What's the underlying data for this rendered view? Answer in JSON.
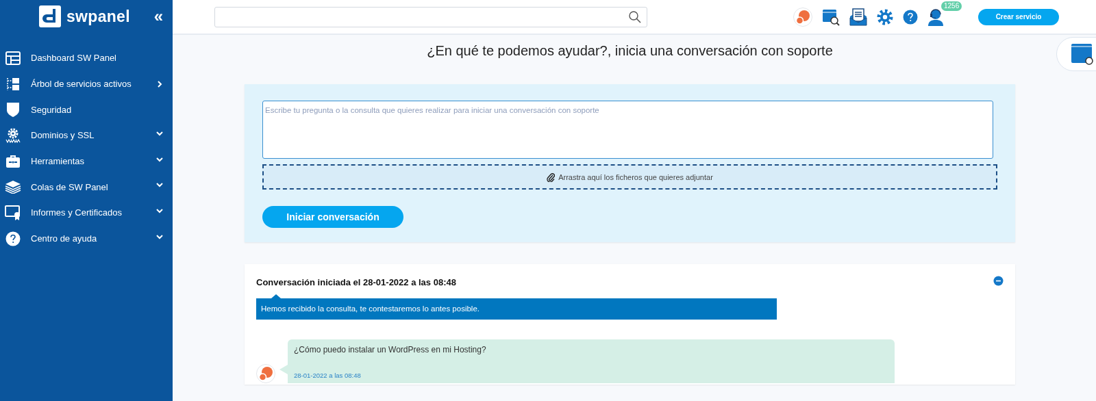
{
  "sidebar": {
    "logo": "swpanel",
    "collapse": "«",
    "items": [
      {
        "label": "Dashboard SW Panel",
        "kind": "link"
      },
      {
        "label": "Árbol de servicios activos",
        "kind": "flyout"
      },
      {
        "label": "Seguridad",
        "kind": "link"
      },
      {
        "label": "Dominios y SSL",
        "kind": "dropdown"
      },
      {
        "label": "Herramientas",
        "kind": "dropdown"
      },
      {
        "label": "Colas de SW Panel",
        "kind": "dropdown"
      },
      {
        "label": "Informes y Certificados",
        "kind": "dropdown"
      },
      {
        "label": "Centro de ayuda",
        "kind": "dropdown"
      }
    ]
  },
  "topbar": {
    "badge": "1256",
    "button": "Crear servicio"
  },
  "heading": "¿En qué te podemos ayudar?, inicia una conversación con soporte",
  "form": {
    "placeholder": "Escribe tu pregunta o la consulta que quieres realizar para iniciar una conversación con soporte",
    "dropzone": "Arrastra aquí los ficheros que quieres adjuntar",
    "button": "Iniciar conversación"
  },
  "conversation": {
    "title": "Conversación iniciada el 28-01-2022 a las 08:48",
    "expanded": true,
    "notice": "Hemos recibido la consulta, te contestaremos lo antes posible.",
    "messages": [
      {
        "text": "¿Cómo puedo instalar un WordPress en mi Hosting?",
        "time": "28-01-2022 a las 08:48"
      }
    ]
  }
}
